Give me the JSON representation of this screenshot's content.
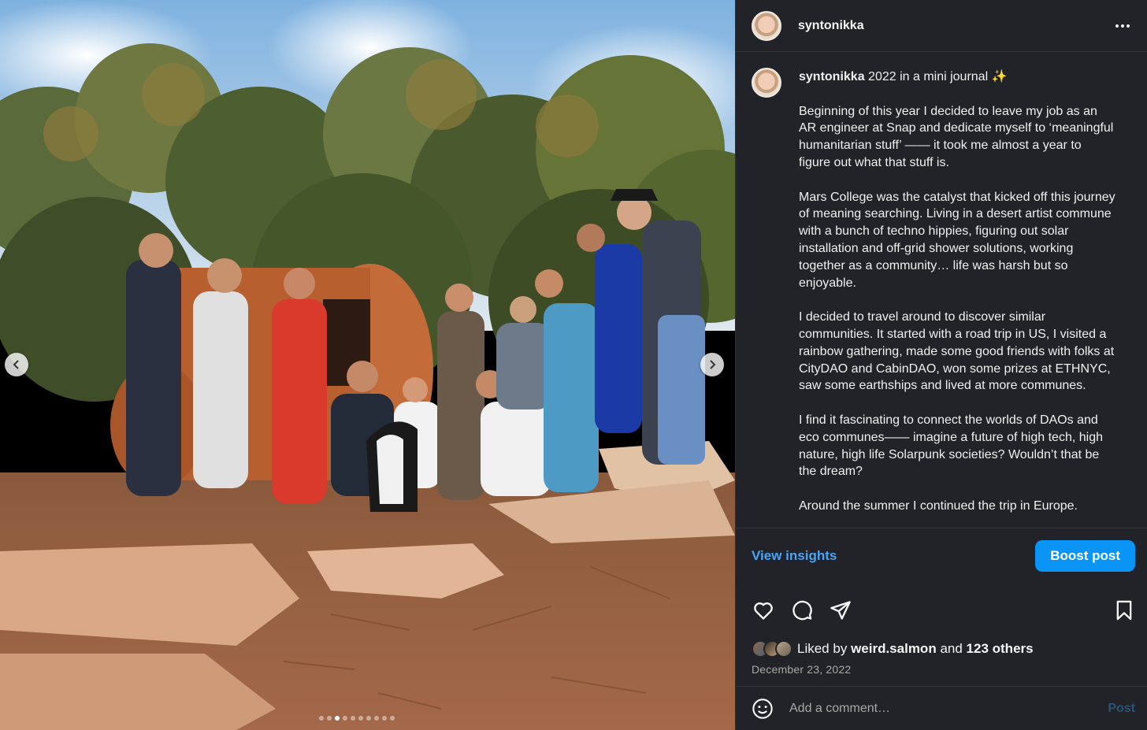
{
  "header": {
    "username": "syntonikka"
  },
  "caption": {
    "username": "syntonikka",
    "title": " 2022 in a mini journal ✨",
    "paragraphs": [
      "Beginning of this year I decided to leave my job as an AR engineer at Snap and dedicate myself to ‘meaningful humanitarian stuff’ —— it took me almost a year to figure out what that stuff is.",
      "Mars College was the catalyst that kicked off this journey of meaning searching. Living in a desert artist commune with a bunch of techno hippies, figuring out solar installation and off-grid shower solutions, working together as a community… life was harsh but so enjoyable.",
      "I decided to travel around to discover similar communities. It started with a road trip in US, I visited a rainbow gathering, made some good friends with folks at CityDAO and CabinDAO, won some prizes at ETHNYC, saw some earthships and lived at more communes.",
      "I find it fascinating to connect the worlds of DAOs and eco communes—— imagine a future of high tech, high nature, high life Solarpunk societies? Wouldn’t that be the dream?",
      "Around the summer I continued the trip in Europe."
    ]
  },
  "actions": {
    "insights_label": "View insights",
    "boost_label": "Boost post"
  },
  "likes": {
    "prefix": "Liked by ",
    "user": "weird.salmon",
    "middle": " and ",
    "others": "123 others"
  },
  "date": "December 23, 2022",
  "comment": {
    "placeholder": "Add a comment…",
    "post_label": "Post"
  },
  "carousel": {
    "total": 10,
    "active_index": 2
  },
  "icons": {
    "like": "heart-icon",
    "comment": "comment-icon",
    "share": "share-icon",
    "save": "bookmark-icon",
    "more": "more-options-icon",
    "emoji": "emoji-icon",
    "prev": "chevron-left-icon",
    "next": "chevron-right-icon"
  },
  "colors": {
    "panel_bg": "#212328",
    "link_blue": "#4aa3f5",
    "boost_blue": "#0a95f6",
    "muted_text": "#a8a8a8"
  }
}
